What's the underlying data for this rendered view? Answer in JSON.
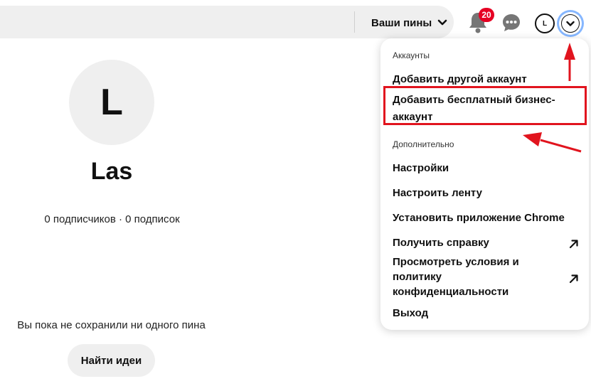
{
  "header": {
    "your_pins_label": "Ваши пины",
    "notifications_count": "20",
    "avatar_initial": "L",
    "icons": {
      "notifications": "bell-icon",
      "messages": "chat-bubble-icon",
      "menu": "chevron-down-icon"
    }
  },
  "profile": {
    "avatar_initial": "L",
    "name": "Las",
    "stats": "0 подписчиков · 0 подписок",
    "empty_message": "Вы пока не сохранили ни одного пина",
    "find_ideas_label": "Найти идеи"
  },
  "menu": {
    "accounts_label": "Аккаунты",
    "add_account": "Добавить другой аккаунт",
    "add_business_line1": "Добавить бесплатный бизнес-",
    "add_business_line2": "аккаунт",
    "more_label": "Дополнительно",
    "settings": "Настройки",
    "tune_feed": "Настроить ленту",
    "install_chrome": "Установить приложение Chrome",
    "get_help": "Получить справку",
    "terms_line1": "Просмотреть условия и",
    "terms_line2": "политику",
    "terms_line3": "конфиденциальности",
    "logout": "Выход"
  },
  "colors": {
    "accent": "#e60023",
    "annotation": "#e1141e",
    "focus_ring": "#86b7ff",
    "surface": "#efefef"
  }
}
